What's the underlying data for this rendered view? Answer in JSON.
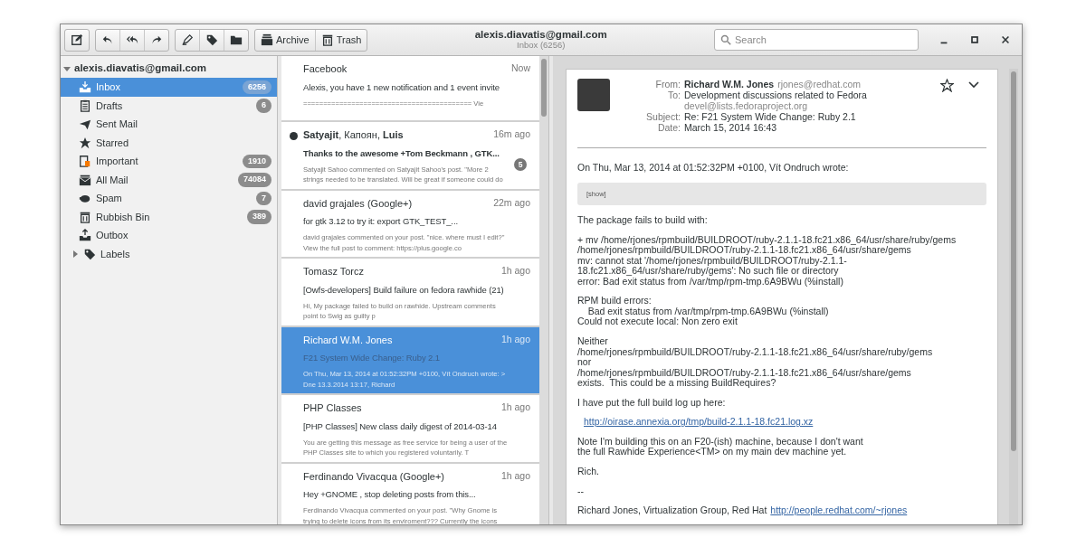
{
  "window": {
    "title": "alexis.diavatis@gmail.com",
    "subtitle": "Inbox (6256)"
  },
  "toolbar": [
    {
      "label": "Archive"
    },
    {
      "label": "Trash"
    }
  ],
  "search": {
    "placeholder": "Search"
  },
  "sidebar": {
    "account": "alexis.diavatis@gmail.com",
    "expanded": true,
    "items": [
      {
        "label": "Inbox",
        "count": "6256",
        "selected": true
      },
      {
        "label": "Drafts",
        "count": "6",
        "selected": false
      },
      {
        "label": "Sent Mail",
        "selected": false
      },
      {
        "label": "Starred",
        "selected": false
      },
      {
        "label": "Important",
        "count": "1910",
        "selected": false
      },
      {
        "label": "All Mail",
        "count": "74084",
        "selected": false
      },
      {
        "label": "Spam",
        "count": "7",
        "selected": false
      },
      {
        "label": "Rubbish Bin",
        "count": "389",
        "selected": false
      },
      {
        "label": "Outbox",
        "selected": false
      }
    ],
    "labels": {
      "label": "Labels",
      "expanded": false
    }
  },
  "messages": [
    {
      "sender": "Facebook",
      "time": "Now",
      "subject": "Alexis, you have 1 new notification and 1 event invite",
      "preview": "========================================== Vie",
      "unread": false,
      "selected": false
    },
    {
      "sender": "**Satyajit**, Капоян, **Luis**",
      "time": "16m ago",
      "subject": "Thanks to the awesome +Tom Beckmann , GTK...",
      "preview": "Satyajit Sahoo commented on Satyajit Sahoo's post. \"More 2 strings needed to be translated. Will be great if someone could do",
      "unread": true,
      "selected": false,
      "thread_count": "5"
    },
    {
      "sender": "david grajales (Google+)",
      "time": "22m ago",
      "subject": "for gtk 3.12 to try it: export GTK_TEST_...",
      "preview": "david grajales commented on your post. \"nice. where must I edit?\" View the full post to comment: https://plus.google.co",
      "unread": false,
      "selected": false
    },
    {
      "sender": "Tomasz Torcz",
      "time": "1h ago",
      "subject": "[Owfs-developers] Build failure on fedora rawhide (21)",
      "preview": "Hi, My package failed to build on rawhide. Upstream comments point to Swig as guilty p",
      "unread": false,
      "selected": false
    },
    {
      "sender": "Richard W.M. Jones",
      "time": "1h ago",
      "subject": "F21 System Wide Change: Ruby 2.1",
      "preview": "On Thu, Mar 13, 2014 at 01:52:32PM +0100, Vít Ondruch wrote: > Dne 13.3.2014 13:17, Richard",
      "unread": false,
      "selected": true
    },
    {
      "sender": "PHP Classes",
      "time": "1h ago",
      "subject": "[PHP Classes] New class daily digest of 2014-03-14",
      "preview": "You are getting this message as free service for being a user of the PHP Classes site to which you registered voluntarily. T",
      "unread": false,
      "selected": false
    },
    {
      "sender": "Ferdinando Vivacqua (Google+)",
      "time": "1h ago",
      "subject": "Hey +GNOME , stop deleting posts from this...",
      "preview": "Ferdinando Vivacqua commented on your post. \"Why Gnome is trying to delete icons from its enviroment??? Currently the icons",
      "unread": false,
      "selected": false
    }
  ],
  "reader": {
    "headers": [
      {
        "label": "From:",
        "value": "Richard W.M. Jones",
        "extra": "rjones@redhat.com"
      },
      {
        "label": "To:",
        "value": "Development discussions related to Fedora",
        "extra": "devel@lists.fedoraproject.org"
      },
      {
        "label": "Subject:",
        "value": "Re: F21 System Wide Change: Ruby 2.1"
      },
      {
        "label": "Date:",
        "value": "March 15, 2014 16:43"
      }
    ],
    "starred": false,
    "body": [
      {
        "kind": "text",
        "text": "On Thu, Mar 13, 2014 at 01:52:32PM +0100, Vít Ondruch wrote:"
      },
      {
        "kind": "quote",
        "text": "[show]"
      },
      {
        "kind": "text",
        "text": "The package fails to build with:"
      },
      {
        "kind": "text",
        "text": "+ mv /home/rjones/rpmbuild/BUILDROOT/ruby-2.1.1-18.fc21.x86_64/usr/share/ruby/gems\n/home/rjones/rpmbuild/BUILDROOT/ruby-2.1.1-18.fc21.x86_64/usr/share/gems\nmv: cannot stat '/home/rjones/rpmbuild/BUILDROOT/ruby-2.1.1-18.fc21.x86_64/usr/share/ruby/gems': No such file or directory\nerror: Bad exit status from /var/tmp/rpm-tmp.6A9BWu (%install)"
      },
      {
        "kind": "text",
        "text": "RPM build errors:\n    Bad exit status from /var/tmp/rpm-tmp.6A9BWu (%install)\nCould not execute local: Non zero exit"
      },
      {
        "kind": "text",
        "text": "Neither\n/home/rjones/rpmbuild/BUILDROOT/ruby-2.1.1-18.fc21.x86_64/usr/share/ruby/gems\nnor\n/home/rjones/rpmbuild/BUILDROOT/ruby-2.1.1-18.fc21.x86_64/usr/share/gems\nexists.  This could be a missing BuildRequires?"
      },
      {
        "kind": "text",
        "text": "I have put the full build log up here:"
      },
      {
        "kind": "link",
        "text": "http://oirase.annexia.org/tmp/build-2.1.1-18.fc21.log.xz"
      },
      {
        "kind": "text",
        "text": "Note I'm building this on an F20-(ish) machine, because I don't want\nthe full Rawhide Experience<TM> on my main dev machine yet."
      },
      {
        "kind": "text",
        "text": "Rich."
      },
      {
        "kind": "text",
        "text": "--"
      },
      {
        "kind": "signature",
        "text": "Richard Jones, Virtualization Group, Red Hat",
        "link": "http://people.redhat.com/~rjones"
      }
    ]
  }
}
